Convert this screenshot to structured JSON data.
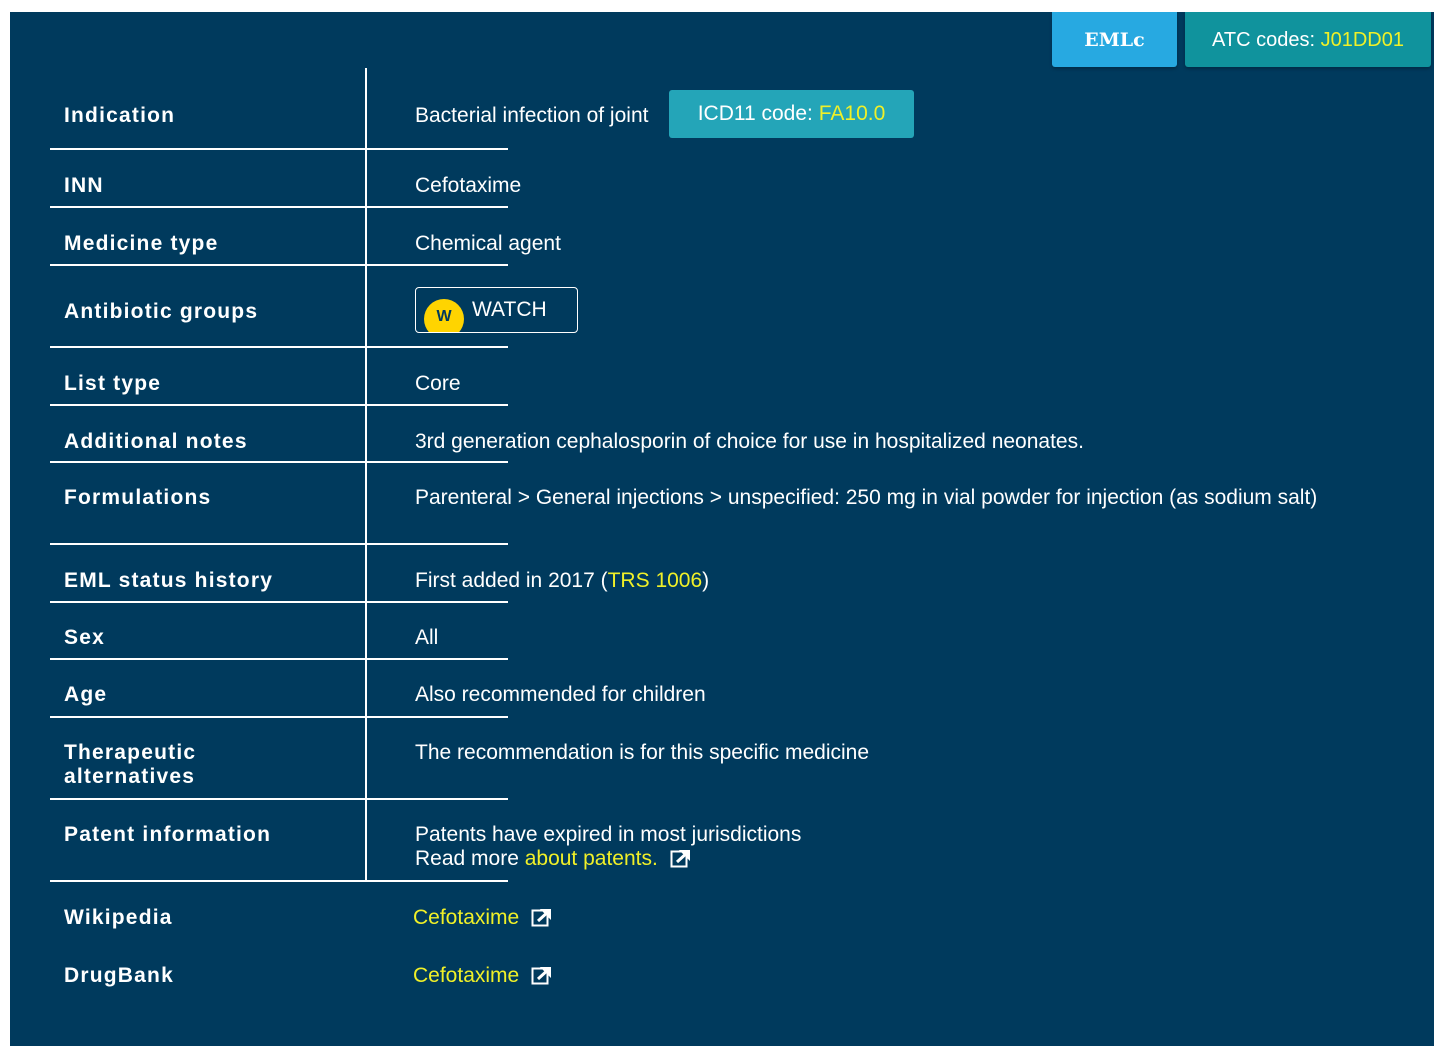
{
  "header": {
    "eml_badge": "EMLc",
    "atc_label": "ATC codes: ",
    "atc_code": "J01DD01"
  },
  "rows": {
    "indication": {
      "label": "Indication",
      "value": "Bacterial infection of joint",
      "icd_label": "ICD11 code: ",
      "icd_code": "FA10.0"
    },
    "inn": {
      "label": "INN",
      "value": "Cefotaxime"
    },
    "medicine_type": {
      "label": "Medicine type",
      "value": "Chemical agent"
    },
    "antibiotic_groups": {
      "label": "Antibiotic groups",
      "badge_letter": "W",
      "badge_text": "WATCH",
      "badge_color": "#ffd400"
    },
    "list_type": {
      "label": "List type",
      "value": "Core"
    },
    "additional_notes": {
      "label": "Additional notes",
      "value": "3rd generation cephalosporin of choice for use in hospitalized neonates."
    },
    "formulations": {
      "label": "Formulations",
      "value": "Parenteral > General injections > unspecified: 250 mg in vial powder for injection (as sodium salt)"
    },
    "eml_status_history": {
      "label": "EML status history",
      "prefix": "First added in 2017 (",
      "link": "TRS 1006",
      "suffix": ")"
    },
    "sex": {
      "label": "Sex",
      "value": "All"
    },
    "age": {
      "label": "Age",
      "value": "Also recommended for children"
    },
    "therapeutic_alternatives": {
      "label_line1": "Therapeutic",
      "label_line2": "alternatives",
      "value": "The recommendation is for this specific medicine"
    },
    "patent_information": {
      "label": "Patent information",
      "line1": "Patents have expired in most jurisdictions",
      "line2_prefix": "Read more ",
      "line2_link": "about patents."
    },
    "wikipedia": {
      "label": "Wikipedia",
      "link": "Cefotaxime"
    },
    "drugbank": {
      "label": "DrugBank",
      "link": "Cefotaxime"
    }
  },
  "colors": {
    "background": "#003a5d",
    "link": "#f0f028",
    "eml_badge": "#27a9e1",
    "atc_badge": "#10939d",
    "icd_badge": "#24a5b8"
  }
}
